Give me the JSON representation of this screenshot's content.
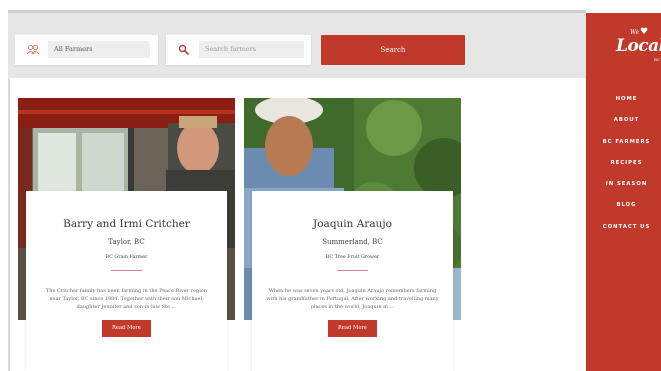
{
  "filters": {
    "category_value": "All Farmers",
    "search_placeholder": "Search farmers",
    "search_button": "Search"
  },
  "brand": {
    "logo_we": "We",
    "logo_main": "Local",
    "logo_bc": "BC"
  },
  "nav": {
    "items": [
      "HOME",
      "ABOUT",
      "BC FARMERS",
      "RECIPES",
      "IN SEASON",
      "BLOG",
      "CONTACT US"
    ]
  },
  "farmers": [
    {
      "name": "Barry and Irmi Critcher",
      "location": "Taylor, BC",
      "type": "BC Grain Farmer",
      "description": "The Critcher family has been farming in the Peace River region near Taylor, BC since 1984. Together with their son Michael, daughter Jennifer and son-in-law Ste ...",
      "button": "Read More"
    },
    {
      "name": "Joaquin Araujo",
      "location": "Summerland, BC",
      "type": "BC Tree Fruit Grower",
      "description": "When he was seven years old, Joaquin Araujo remembers farming with his grandfather in Portugal. After working and travelling many places in the world, Joaquin m ...",
      "button": "Read More"
    }
  ],
  "colors": {
    "accent": "#c0392b",
    "filter_bar": "#e6e6e6",
    "field": "#eeeeee"
  },
  "icons": {
    "category": "people-icon",
    "search": "search-icon"
  }
}
